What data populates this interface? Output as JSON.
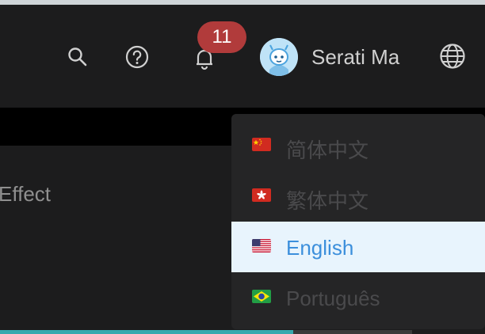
{
  "header": {
    "notification_count": "11",
    "username": "Serati Ma",
    "icons": [
      "search-icon",
      "help-icon",
      "bell-icon",
      "avatar",
      "globe-icon"
    ]
  },
  "panel": {
    "partial_text": "Effect"
  },
  "language_menu": {
    "items": [
      {
        "label": "简体中文",
        "flag": "cn-flag-icon",
        "selected": false
      },
      {
        "label": "繁体中文",
        "flag": "hk-flag-icon",
        "selected": false
      },
      {
        "label": "English",
        "flag": "us-flag-icon",
        "selected": true
      },
      {
        "label": "Português",
        "flag": "br-flag-icon",
        "selected": false
      }
    ]
  },
  "colors": {
    "header_bg": "#1c1c1d",
    "badge": "#b13b3b",
    "selected_bg": "#e8f4fd",
    "selected_text": "#3c8fdc",
    "accent_bar": "#37a9ae"
  }
}
